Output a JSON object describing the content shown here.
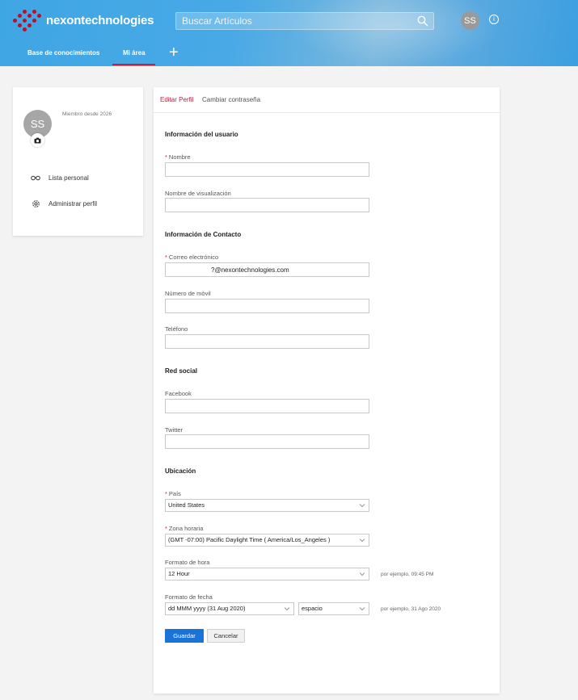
{
  "header": {
    "brand": "nexontechnologies",
    "search_placeholder": "Buscar Artículos",
    "avatar_initials": "SS",
    "accessibility_glyph": "i",
    "nav": [
      {
        "label": "Base de conocimientos"
      },
      {
        "label": "Mi área",
        "active": true
      }
    ],
    "add_glyph": "+",
    "colors": {
      "accent": "#c0203e",
      "header_bg": "#3fa6e4"
    }
  },
  "profile_card": {
    "avatar_initials": "SS",
    "member_since": "Miembro desde 2026",
    "links": [
      {
        "label": "Lista personal",
        "icon": "glasses-icon"
      },
      {
        "label": "Administrar perfil",
        "icon": "gear-icon"
      }
    ]
  },
  "tabs": [
    {
      "label": "Editar Perfil",
      "active": true
    },
    {
      "label": "Cambiar contraseña",
      "active": false
    }
  ],
  "form": {
    "user_info": {
      "title": "Información del usuario",
      "name_label": "Nombre",
      "name_value": "",
      "display_name_label": "Nombre de visualización",
      "display_name_value": ""
    },
    "contact": {
      "title": "Información de Contacto",
      "email_label": "Correo electrónico",
      "email_value": "?@nexontechnologies.com",
      "mobile_label": "Número de móvil",
      "mobile_value": "",
      "phone_label": "Teléfono",
      "phone_value": ""
    },
    "social": {
      "title": "Red social",
      "facebook_label": "Facebook",
      "facebook_value": "",
      "twitter_label": "Twitter",
      "twitter_value": ""
    },
    "location": {
      "title": "Ubicación",
      "country_label": "País",
      "country_value": "United States",
      "timezone_label": "Zona horaria",
      "timezone_value": "(GMT -07:00) Pacific Daylight Time ( America/Los_Angeles )",
      "time_format_label": "Formato de hora",
      "time_format_value": "12 Hour",
      "time_format_hint": "por ejemplo, 09:45 PM",
      "date_format_label": "Formato de fecha",
      "date_format_value": "dd MMM yyyy (31 Aug 2020)",
      "date_separator_value": "espacio",
      "date_format_hint": "por ejemplo, 31 Ago 2020"
    },
    "required_marker": "*",
    "save_label": "Guardar",
    "cancel_label": "Cancelar"
  }
}
